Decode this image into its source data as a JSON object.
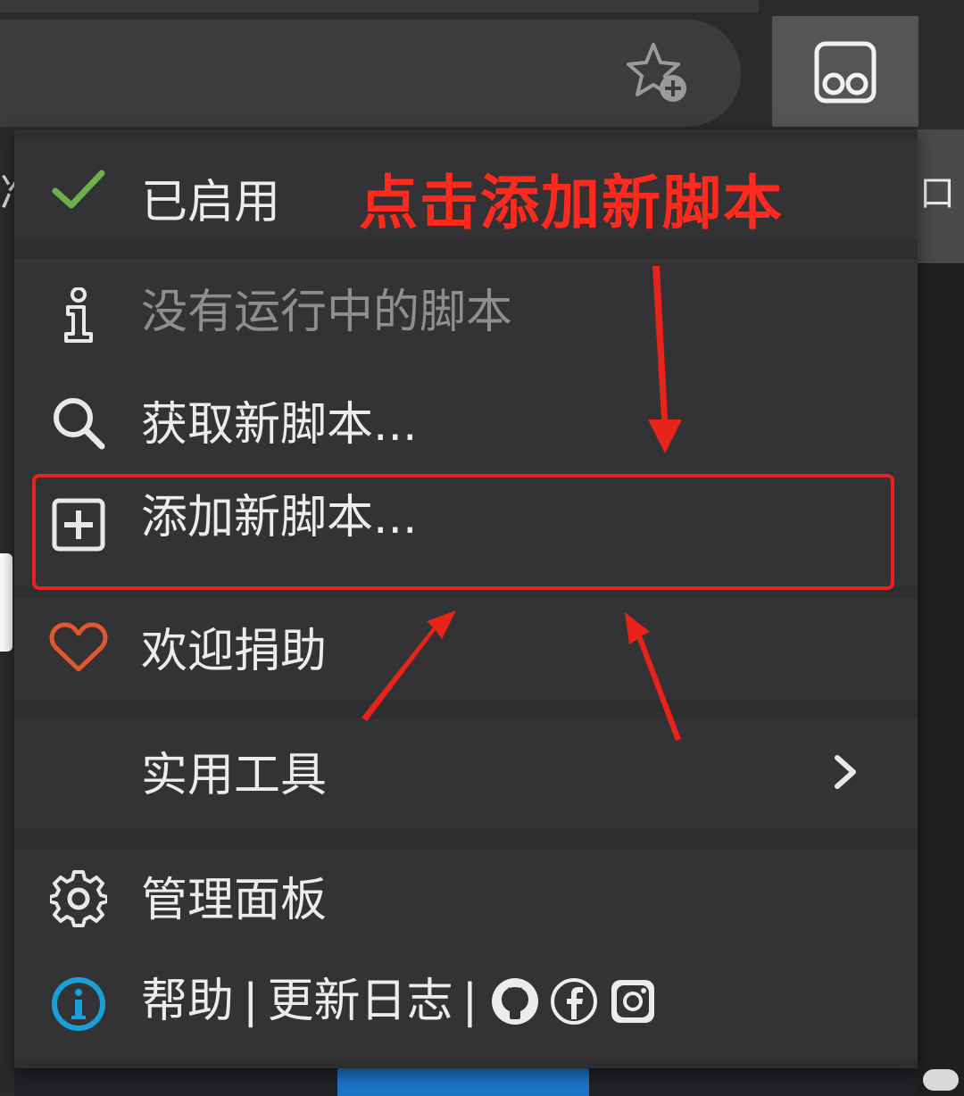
{
  "menu": {
    "enabled": {
      "label": "已启用",
      "icon": "checkmark-icon"
    },
    "no_running": {
      "label": "没有运行中的脚本",
      "icon": "info-icon"
    },
    "get_scripts": {
      "label": "获取新脚本...",
      "icon": "search-icon"
    },
    "add_script": {
      "label": "添加新脚本...",
      "icon": "plus-square-icon"
    },
    "donate": {
      "label": "欢迎捐助",
      "icon": "heart-icon"
    },
    "utilities": {
      "label": "实用工具",
      "icon": "chevron-right-icon"
    },
    "dashboard": {
      "label": "管理面板",
      "icon": "gear-icon"
    },
    "help": {
      "help_label": "帮助",
      "separator": "|",
      "changelog_label": "更新日志",
      "icon": "info-circle-icon",
      "social_icons": [
        "github-icon",
        "facebook-icon",
        "instagram-icon"
      ]
    }
  },
  "annotation": {
    "text": "点击添加新脚本",
    "color": "#ff2a1e"
  },
  "colors": {
    "menu_bg": "#333335",
    "check_green": "#6ab04c",
    "heart_orange": "#e2582c",
    "help_blue": "#1a9fd8",
    "highlight_red": "#e8231a"
  },
  "partial_edge_text": {
    "left": "准",
    "right": "口"
  }
}
